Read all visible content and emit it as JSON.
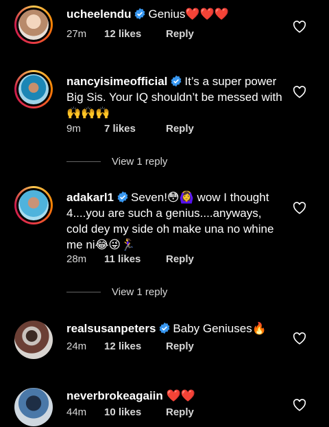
{
  "comments": [
    {
      "username": "ucheelendu",
      "text": "Genius❤️❤️❤️",
      "time": "27m",
      "likes": "12 likes",
      "reply": "Reply",
      "story_ring": true,
      "avatar_color": "#d9b89a"
    },
    {
      "username": "nancyisimeofficial",
      "text": "It’s a super power Big Sis. Your IQ shouldn’t be messed with🙌🙌🙌",
      "time": "9m",
      "likes": "7 likes",
      "reply": "Reply",
      "view_replies": "View 1 reply",
      "story_ring": true,
      "avatar_color": "#4aa3c7"
    },
    {
      "username": "adakarl1",
      "text": "Seven!😳🙆‍♀️ wow I thought 4....you are such a genius....anyways, cold dey my side oh make una no whine me ni😂😜🏃‍♀️",
      "time": "28m",
      "likes": "11 likes",
      "reply": "Reply",
      "view_replies": "View 1 reply",
      "story_ring": true,
      "avatar_color": "#5fb6d8"
    },
    {
      "username": "realsusanpeters",
      "text": "Baby Geniuses🔥",
      "time": "24m",
      "likes": "12 likes",
      "reply": "Reply",
      "story_ring": false,
      "avatar_color": "#7a5545"
    },
    {
      "username": "neverbrokeagaiin",
      "text": "❤️❤️",
      "time": "44m",
      "likes": "10 likes",
      "reply": "Reply",
      "story_ring": false,
      "avatar_color": "#3a6a9a"
    }
  ],
  "colors": {
    "background": "#000000",
    "verified_badge": "#3897f0",
    "secondary_text": "#d8d8d8"
  }
}
